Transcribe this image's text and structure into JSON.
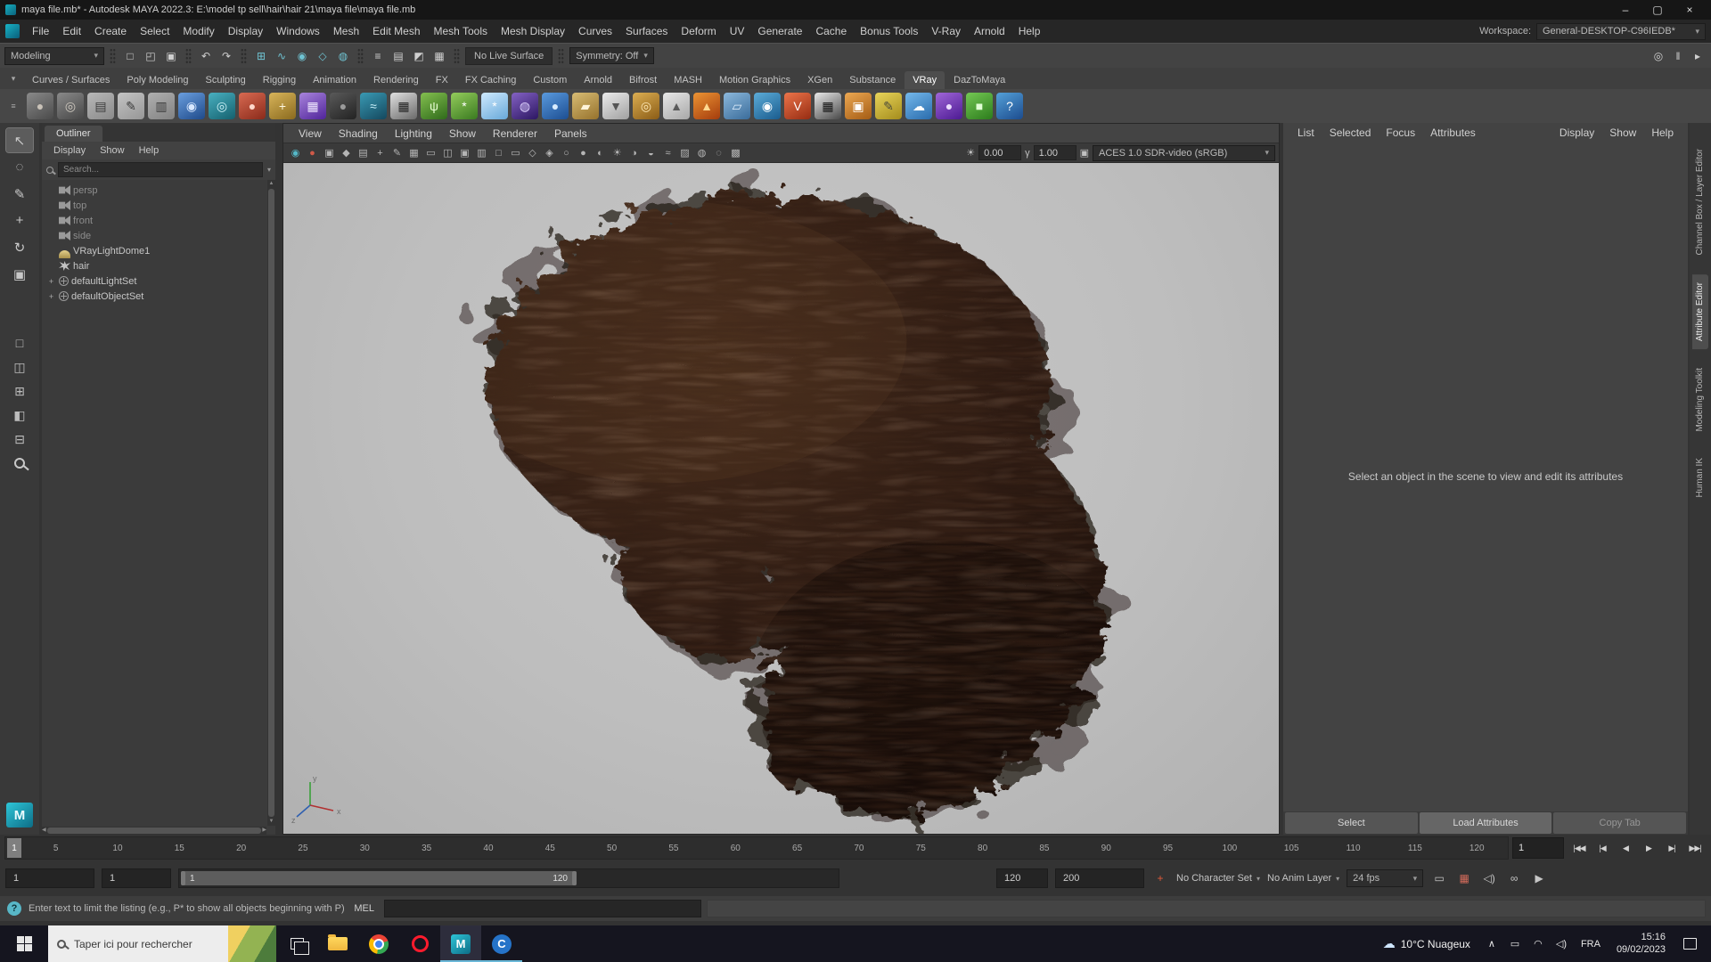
{
  "glyphs": {
    "chevron_down": "▾",
    "chevron_up": "∧",
    "minimize": "–",
    "maximize": "▢",
    "close": "×",
    "question": "?",
    "cloud": "☁",
    "sun": "☀",
    "gamma": "γ",
    "grip": "≡",
    "menu_chev": "▾",
    "scroll_up": "▲",
    "scroll_down": "▼",
    "scroll_left": "◀",
    "scroll_right": "▶",
    "camera_box": "▣"
  },
  "window": {
    "title": "maya file.mb* - Autodesk MAYA 2022.3: E:\\model tp sell\\hair\\hair 21\\maya file\\maya file.mb"
  },
  "menubar": {
    "items": [
      "File",
      "Edit",
      "Create",
      "Select",
      "Modify",
      "Display",
      "Windows",
      "Mesh",
      "Edit Mesh",
      "Mesh Tools",
      "Mesh Display",
      "Curves",
      "Surfaces",
      "Deform",
      "UV",
      "Generate",
      "Cache",
      "Bonus Tools",
      "V-Ray",
      "Arnold",
      "Help"
    ],
    "workspace_label": "Workspace:",
    "workspace_value": "General-DESKTOP-C96IEDB*"
  },
  "statusline": {
    "mode": "Modeling",
    "file_icons": [
      {
        "name": "new-scene-icon",
        "glyph": "□"
      },
      {
        "name": "open-scene-icon",
        "glyph": "◰"
      },
      {
        "name": "save-scene-icon",
        "glyph": "▣"
      }
    ],
    "undo_icons": [
      {
        "name": "undo-icon",
        "glyph": "↶"
      },
      {
        "name": "redo-icon",
        "glyph": "↷"
      }
    ],
    "snap_icons": [
      {
        "name": "snap-to-grid-icon",
        "glyph": "⊞",
        "fg": "#6fc3d2"
      },
      {
        "name": "snap-to-curve-icon",
        "glyph": "∿",
        "fg": "#6fc3d2"
      },
      {
        "name": "snap-to-point-icon",
        "glyph": "◉",
        "fg": "#6fc3d2"
      },
      {
        "name": "snap-to-plane-icon",
        "glyph": "◇",
        "fg": "#6fc3d2"
      },
      {
        "name": "make-live-icon",
        "glyph": "◍",
        "fg": "#6fc3d2"
      }
    ],
    "history_icons": [
      {
        "name": "construction-history-icon",
        "glyph": "≡"
      },
      {
        "name": "render-settings-icon",
        "glyph": "▤"
      },
      {
        "name": "hypershade-icon",
        "glyph": "◩"
      },
      {
        "name": "render-view-icon",
        "glyph": "▦"
      }
    ],
    "no_live_surface": "No Live Surface",
    "symmetry": "Symmetry: Off",
    "right_icons": [
      {
        "name": "highlight-selection-icon",
        "glyph": "◎"
      },
      {
        "name": "pause-viewport-icon",
        "glyph": "‖"
      },
      {
        "name": "sequencer-icon",
        "glyph": "▸"
      }
    ]
  },
  "shelf": {
    "tabs": [
      {
        "label": "Curves / Surfaces"
      },
      {
        "label": "Poly Modeling"
      },
      {
        "label": "Sculpting"
      },
      {
        "label": "Rigging"
      },
      {
        "label": "Animation"
      },
      {
        "label": "Rendering"
      },
      {
        "label": "FX"
      },
      {
        "label": "FX Caching"
      },
      {
        "label": "Custom"
      },
      {
        "label": "Arnold"
      },
      {
        "label": "Bifrost"
      },
      {
        "label": "MASH"
      },
      {
        "label": "Motion Graphics"
      },
      {
        "label": "XGen"
      },
      {
        "label": "Substance"
      },
      {
        "label": "VRay",
        "active": true
      },
      {
        "label": "DazToMaya"
      }
    ],
    "icons": [
      {
        "name": "nurbs-sphere-icon",
        "glyph": "●",
        "c1": "#8a8a8a",
        "c2": "#4a4a4a",
        "fg": "#c9c2b8"
      },
      {
        "name": "nurbs-torus-icon",
        "glyph": "◎",
        "c1": "#8a8a8a",
        "c2": "#464646",
        "fg": "#d0cac0"
      },
      {
        "name": "curve-document-icon",
        "glyph": "▤",
        "c1": "#b8b8b8",
        "c2": "#8a8a8a",
        "fg": "#3a3a3a"
      },
      {
        "name": "pencil-curve-icon",
        "glyph": "✎",
        "c1": "#c4c4c4",
        "c2": "#969696",
        "fg": "#3a3a3a"
      },
      {
        "name": "measure-tool-icon",
        "glyph": "▥",
        "c1": "#b0b0b0",
        "c2": "#828282",
        "fg": "#3a3a3a"
      },
      {
        "name": "shiny-sphere-icon",
        "glyph": "◉",
        "c1": "#6a9ede",
        "c2": "#1e4a8a",
        "fg": "#d8e8ff"
      },
      {
        "name": "atom-icon",
        "glyph": "◎",
        "c1": "#49b0c0",
        "c2": "#14606e",
        "fg": "#d0f4fa"
      },
      {
        "name": "red-shader-sphere-icon",
        "glyph": "●",
        "c1": "#d86a52",
        "c2": "#8a2a1a",
        "fg": "#ffd8cc"
      },
      {
        "name": "gold-tool-icon",
        "glyph": "+",
        "c1": "#d8b45a",
        "c2": "#8a6a1e",
        "fg": "#fff8e0"
      },
      {
        "name": "uv-checker-icon",
        "glyph": "▦",
        "c1": "#a884dc",
        "c2": "#50249a",
        "fg": "#f0e8ff"
      },
      {
        "name": "black-sphere-icon",
        "glyph": "●",
        "c1": "#5a5a5a",
        "c2": "#222222",
        "fg": "#9a9a9a"
      },
      {
        "name": "ocean-shader-icon",
        "glyph": "≈",
        "c1": "#3a9ab4",
        "c2": "#14485e",
        "fg": "#c8f0fa"
      },
      {
        "name": "checker-map-icon",
        "glyph": "▦",
        "c1": "#e0e0e0",
        "c2": "#6a6a6a",
        "fg": "#222222"
      },
      {
        "name": "grass-icon",
        "glyph": "ψ",
        "c1": "#84c050",
        "c2": "#2f6a1a",
        "fg": "#e8ffd4"
      },
      {
        "name": "flower-icon",
        "glyph": "*",
        "c1": "#94cc5c",
        "c2": "#3a7a20",
        "fg": "#ffffff"
      },
      {
        "name": "snowflake-icon",
        "glyph": "*",
        "c1": "#cfeaff",
        "c2": "#68a8d8",
        "fg": "#ffffff"
      },
      {
        "name": "galaxy-icon",
        "glyph": "◍",
        "c1": "#8462c4",
        "c2": "#2c1662",
        "fg": "#e0d4ff"
      },
      {
        "name": "waterdrop-icon",
        "glyph": "●",
        "c1": "#5a9ade",
        "c2": "#1c4e92",
        "fg": "#d8ecff"
      },
      {
        "name": "sand-solid-icon",
        "glyph": "▰",
        "c1": "#d8bc74",
        "c2": "#96722c",
        "fg": "#fff4da"
      },
      {
        "name": "funnel-icon",
        "glyph": "▼",
        "c1": "#ececec",
        "c2": "#a0a0a0",
        "fg": "#555555"
      },
      {
        "name": "gold-ring-icon",
        "glyph": "◎",
        "c1": "#dcae52",
        "c2": "#8a5c16",
        "fg": "#ffe9b8"
      },
      {
        "name": "cone-primitive-icon",
        "glyph": "▲",
        "c1": "#e8e8e8",
        "c2": "#a8a8a8",
        "fg": "#5a5a5a"
      },
      {
        "name": "fire-fx-icon",
        "glyph": "▲",
        "c1": "#ec9434",
        "c2": "#a43c0c",
        "fg": "#ffd890"
      },
      {
        "name": "glass-pane-icon",
        "glyph": "▱",
        "c1": "#8cb8dc",
        "c2": "#3a6c9a",
        "fg": "#e4f2ff"
      },
      {
        "name": "fluid-sphere-icon",
        "glyph": "◉",
        "c1": "#5cacd8",
        "c2": "#1a5c8e",
        "fg": "#ffffff"
      },
      {
        "name": "vray-render-icon",
        "glyph": "V",
        "c1": "#ec744a",
        "c2": "#962c12",
        "fg": "#ffffff"
      },
      {
        "name": "vray-checker-icon",
        "glyph": "▦",
        "c1": "#e8e8e8",
        "c2": "#4a4a4a",
        "fg": "#141414"
      },
      {
        "name": "camera-tool-icon",
        "glyph": "▣",
        "c1": "#eca852",
        "c2": "#a45c14",
        "fg": "#ffffff"
      },
      {
        "name": "sketch-book-icon",
        "glyph": "✎",
        "c1": "#e8d45a",
        "c2": "#a48c1c",
        "fg": "#4a4a3a"
      },
      {
        "name": "daz-cloud-icon",
        "glyph": "☁",
        "c1": "#74b8ec",
        "c2": "#2a6cac",
        "fg": "#ffffff"
      },
      {
        "name": "daz-purple-icon",
        "glyph": "●",
        "c1": "#a066d8",
        "c2": "#4c1a92",
        "fg": "#ecdcff"
      },
      {
        "name": "daz-green-icon",
        "glyph": "■",
        "c1": "#74c854",
        "c2": "#2c7c1c",
        "fg": "#e0ffd4"
      },
      {
        "name": "help-docs-icon",
        "glyph": "?",
        "c1": "#54a0d8",
        "c2": "#1c4c8e",
        "fg": "#ffffff"
      }
    ]
  },
  "toolbox": {
    "tools": [
      {
        "name": "select-tool",
        "glyph": "↖",
        "active": true
      },
      {
        "name": "lasso-tool",
        "glyph": "◌"
      },
      {
        "name": "paint-selection-tool",
        "glyph": "✎"
      },
      {
        "name": "move-tool",
        "glyph": "+"
      },
      {
        "name": "rotate-tool",
        "glyph": "↻"
      },
      {
        "name": "scale-tool",
        "glyph": "▣"
      }
    ],
    "layouts": [
      {
        "name": "layout-single-pane",
        "glyph": "□"
      },
      {
        "name": "layout-two-pane",
        "glyph": "◫"
      },
      {
        "name": "layout-four-pane",
        "glyph": "⊞"
      },
      {
        "name": "layout-outliner-persp",
        "glyph": "◧"
      },
      {
        "name": "layout-hypershade",
        "glyph": "⊟"
      }
    ],
    "logo": "M"
  },
  "outliner": {
    "title": "Outliner",
    "menus": [
      "Display",
      "Show",
      "Help"
    ],
    "search_placeholder": "Search...",
    "items": [
      {
        "label": "persp",
        "icon": "camera",
        "dim": true
      },
      {
        "label": "top",
        "icon": "camera",
        "dim": true
      },
      {
        "label": "front",
        "icon": "camera",
        "dim": true
      },
      {
        "label": "side",
        "icon": "camera",
        "dim": true
      },
      {
        "label": "VRayLightDome1",
        "icon": "dome"
      },
      {
        "label": "hair",
        "icon": "hair"
      },
      {
        "label": "defaultLightSet",
        "icon": "set",
        "expander": "+"
      },
      {
        "label": "defaultObjectSet",
        "icon": "set",
        "expander": "+"
      }
    ]
  },
  "viewport": {
    "menus": [
      "View",
      "Shading",
      "Lighting",
      "Show",
      "Renderer",
      "Panels"
    ],
    "toolbar_icons": [
      {
        "name": "viewport-camera-icon",
        "glyph": "◉",
        "fg": "#54b8c8"
      },
      {
        "name": "render-sphere-icon",
        "glyph": "●",
        "fg": "#d05a48"
      },
      {
        "name": "camera-attributes-icon",
        "glyph": "▣"
      },
      {
        "name": "bookmark-icon",
        "glyph": "◆"
      },
      {
        "name": "image-plane-icon",
        "glyph": "▤"
      },
      {
        "name": "pan-zoom-icon",
        "glyph": "+"
      },
      {
        "name": "grease-pencil-icon",
        "glyph": "✎"
      },
      {
        "name": "grid-icon",
        "glyph": "▦"
      },
      {
        "name": "film-gate-icon",
        "glyph": "▭"
      },
      {
        "name": "resolution-gate-icon",
        "glyph": "◫"
      },
      {
        "name": "gate-mask-icon",
        "glyph": "▣"
      },
      {
        "name": "field-chart-icon",
        "glyph": "▥"
      },
      {
        "name": "safe-action-icon",
        "glyph": "□"
      },
      {
        "name": "safe-title-icon",
        "glyph": "▭"
      },
      {
        "name": "frame-all-icon",
        "glyph": "◇"
      },
      {
        "name": "frame-selection-ic",
        "glyph": "◈"
      },
      {
        "name": "wireframe-icon",
        "glyph": "○"
      },
      {
        "name": "shaded-mode-icon",
        "glyph": "●"
      },
      {
        "name": "textured-mode-icon",
        "glyph": "◐"
      },
      {
        "name": "use-all-lights-icon",
        "glyph": "☀"
      },
      {
        "name": "shadows-icon",
        "glyph": "◑"
      },
      {
        "name": "occlusion-icon",
        "glyph": "◒"
      },
      {
        "name": "motion-blur-icon",
        "glyph": "≈"
      },
      {
        "name": "multisample-icon",
        "glyph": "▨"
      },
      {
        "name": "depth-of-field-icon",
        "glyph": "◍"
      },
      {
        "name": "isolate-select-icon",
        "glyph": "◌"
      },
      {
        "name": "xray-icon",
        "glyph": "▩"
      }
    ],
    "exposure": "0.00",
    "gamma": "1.00",
    "colorspace": "ACES 1.0 SDR-video (sRGB)",
    "axis": {
      "x": "x",
      "y": "y",
      "z": "z"
    }
  },
  "attribute_editor": {
    "menus_left": [
      "List",
      "Selected",
      "Focus",
      "Attributes"
    ],
    "menus_right": [
      "Display",
      "Show",
      "Help"
    ],
    "empty_message": "Select an object in the scene to view and edit its attributes",
    "buttons": [
      {
        "label": "Select"
      },
      {
        "label": "Load Attributes",
        "emph": true
      },
      {
        "label": "Copy Tab",
        "dim": true
      }
    ],
    "side_tabs": [
      {
        "label": "Channel Box / Layer Editor"
      },
      {
        "label": "Attribute Editor",
        "active": true
      },
      {
        "label": "Modeling Toolkit"
      },
      {
        "label": "Human IK"
      }
    ]
  },
  "timeline": {
    "marker": "1",
    "ticks": [
      "5",
      "10",
      "15",
      "20",
      "25",
      "30",
      "35",
      "40",
      "45",
      "50",
      "55",
      "60",
      "65",
      "70",
      "75",
      "80",
      "85",
      "90",
      "95",
      "100",
      "105",
      "110",
      "115",
      "120"
    ],
    "current_frame": "1",
    "playback": [
      {
        "name": "go-to-start-button",
        "glyph": "|◀◀"
      },
      {
        "name": "step-back-frame-button",
        "glyph": "|◀"
      },
      {
        "name": "play-backwards-button",
        "glyph": "◀"
      },
      {
        "name": "play-forwards-button",
        "glyph": "▶"
      },
      {
        "name": "step-forward-frame-button",
        "glyph": "▶|"
      },
      {
        "name": "go-to-end-button",
        "glyph": "▶▶|"
      }
    ]
  },
  "range": {
    "anim_start": "1",
    "playback_start": "1",
    "bar_start_label": "1",
    "bar_end_label": "120",
    "playback_end": "120",
    "anim_end": "200",
    "auto_key": {
      "glyph": "+",
      "fg": "#e05a3a"
    },
    "character_set": "No Character Set",
    "anim_layer": "No Anim Layer",
    "fps": "24 fps",
    "extra_icons": [
      {
        "name": "playback-options-icon",
        "glyph": "▭"
      },
      {
        "name": "cached-playback-icon",
        "glyph": "▦",
        "fg": "#d06a5a"
      },
      {
        "name": "mute-audio-icon",
        "glyph": "◁)"
      },
      {
        "name": "loop-icon",
        "glyph": "∞"
      },
      {
        "name": "playback-speed-icon",
        "glyph": "▶"
      }
    ]
  },
  "command_line": {
    "hint": "Enter text to limit the listing (e.g., P* to show all objects beginning with P)",
    "mel_label": "MEL"
  },
  "taskbar": {
    "search_placeholder": "Taper ici pour rechercher",
    "maya_letter": "M",
    "c_letter": "C",
    "weather": "10°C Nuageux",
    "tray_icons": [
      {
        "name": "tray-chevron-icon",
        "glyph": "∧"
      },
      {
        "name": "display-icon",
        "glyph": "▭"
      },
      {
        "name": "network-icon",
        "glyph": "◠"
      },
      {
        "name": "volume-icon",
        "glyph": "◁)"
      }
    ],
    "language": "FRA",
    "time": "15:16",
    "date": "09/02/2023"
  }
}
